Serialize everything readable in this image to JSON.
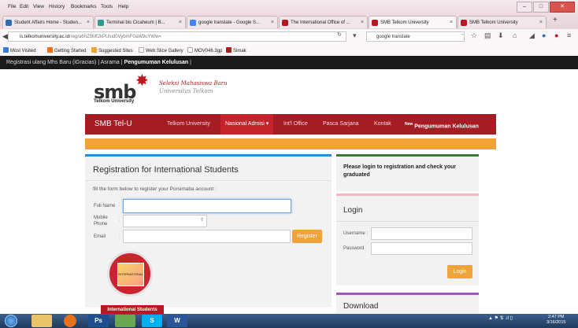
{
  "browser": {
    "menu": [
      "File",
      "Edit",
      "View",
      "History",
      "Bookmarks",
      "Tools",
      "Help"
    ],
    "window_controls": [
      "–",
      "□",
      "✕"
    ],
    "tabs": [
      {
        "label": "Student Affairs Home - Studen...",
        "icon_color": "#2a6db5"
      },
      {
        "label": "Terminal bis Cicaheum | B...",
        "icon_color": "#2a9d8f"
      },
      {
        "label": "google translate - Google S...",
        "icon_color": "#4285f4"
      },
      {
        "label": "The International Office of ...",
        "icon_color": "#b8191f"
      },
      {
        "label": "SMB Telkom University",
        "icon_color": "#b8191f"
      },
      {
        "label": "SMB Telkom University",
        "icon_color": "#b8191f"
      }
    ],
    "tab_close": "×",
    "new_tab": "+",
    "url_domain": "is.telkomuniversity.ac.id",
    "url_rest": "/reg/a6hZ5Mf2kPUlud0VybmF0aW9uYWw=",
    "search_value": "google translate",
    "bookmarks": [
      {
        "label": "Most Visited",
        "color": "#3a7bd5"
      },
      {
        "label": "Getting Started",
        "color": "#e8711a"
      },
      {
        "label": "Suggested Sites",
        "color": "#f0a33a"
      },
      {
        "label": "Web Slice Gallery",
        "color": "#dddddd"
      },
      {
        "label": "MOV046.3gp",
        "color": "#dddddd"
      },
      {
        "label": "Simak",
        "color": "#b8191f"
      }
    ]
  },
  "site": {
    "topstrip": {
      "prefix": "Registrasi ulang Mhs Baru (iGracias) | Asrama |",
      "bold": "Pengumuman Kelulusan",
      "suffix": "|"
    },
    "logo": {
      "main": "smb",
      "sub": "Telkom University",
      "tagline1": "Seleksi Mahasiswa Baru",
      "tagline2": "Universitas Telkom"
    },
    "nav": {
      "brand": "SMB Tel-U",
      "items": [
        {
          "label": "Telkom University"
        },
        {
          "label": "Nasional Admisi ▾"
        },
        {
          "label": "Int'l Office"
        },
        {
          "label": "Pasca Sarjana"
        },
        {
          "label": "Kontak"
        }
      ],
      "new_sup": "New",
      "highlight": "Pengumuman Kelulusan"
    },
    "registration": {
      "title": "Registration for International Students",
      "instructions": "fill the form below to register your Porsimaba account :",
      "full_name_label": "Full Name",
      "mobile_label": "Mobile Phone",
      "email_label": "Email",
      "colon": ":",
      "register_button": "Register",
      "badge_text": "INTERNATIONAL STUDENTS",
      "intl_button": "International Students"
    },
    "notice": {
      "text": "Please login to registration and check your graduated"
    },
    "login": {
      "title": "Login",
      "username_label": "Username :",
      "password_label": "Password",
      "login_button": "Login"
    },
    "download": {
      "title": "Download"
    }
  },
  "taskbar": {
    "apps": [
      "",
      "",
      "",
      "Ps",
      "",
      "S",
      "W"
    ],
    "tray": "▲ ⚑ ⇅ .ıl ▯",
    "time": "2:47 PM",
    "date": "3/16/2015"
  }
}
